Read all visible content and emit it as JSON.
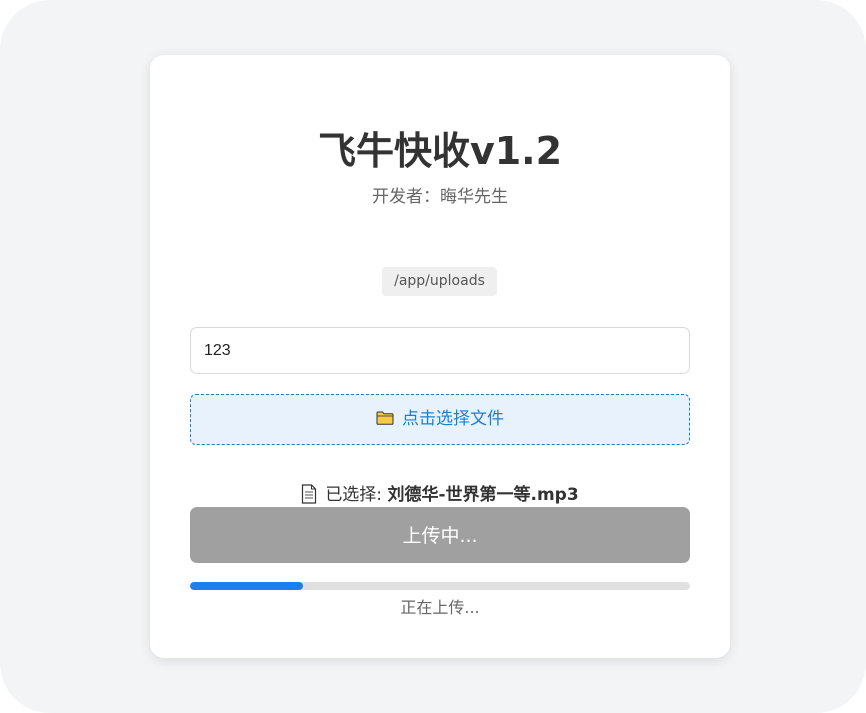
{
  "app": {
    "title": "飞牛快收v1.2",
    "developer": "开发者：晦华先生"
  },
  "upload_path": "/app/uploads",
  "name_input": {
    "value": "123"
  },
  "file_picker": {
    "label": "点击选择文件",
    "icon": "folder-icon"
  },
  "selection": {
    "icon": "document-icon",
    "prefix": "已选择: ",
    "filename": "刘德华-世界第一等.mp3"
  },
  "upload_button": {
    "label": "上传中..."
  },
  "progress": {
    "fraction": 0.226,
    "status": "正在上传..."
  },
  "colors": {
    "accent": "#1a7fd4",
    "progress": "#1a7ff0",
    "button_disabled": "#a0a0a0"
  }
}
